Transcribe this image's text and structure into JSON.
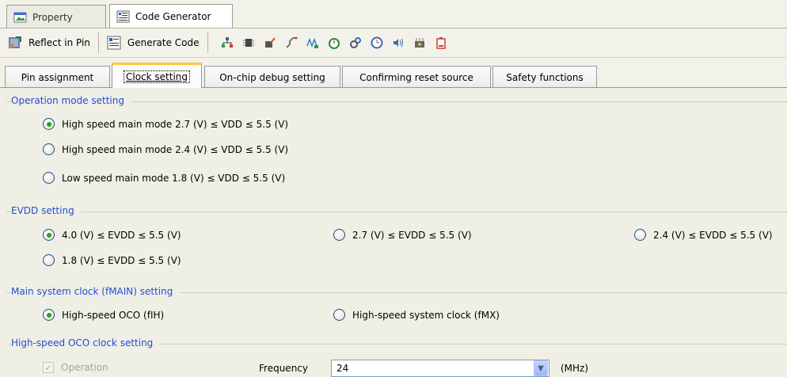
{
  "doc_tabs": [
    {
      "label": "Property",
      "icon": "property-icon",
      "active": false
    },
    {
      "label": "Code Generator",
      "icon": "code-generator-icon",
      "active": true
    }
  ],
  "toolbar": {
    "reflect_label": "Reflect in Pin",
    "generate_label": "Generate Code",
    "icons": [
      "pin-icon",
      "chip-icon",
      "edit-icon",
      "connector-icon",
      "wave-icon",
      "timer-icon",
      "gears-icon",
      "clock-icon",
      "sound-icon",
      "board-icon",
      "battery-icon"
    ]
  },
  "tabs": [
    {
      "label": "Pin assignment",
      "active": false
    },
    {
      "label": "Clock setting",
      "active": true
    },
    {
      "label": "On-chip debug setting",
      "active": false
    },
    {
      "label": "Confirming reset source",
      "active": false
    },
    {
      "label": "Safety functions",
      "active": false
    }
  ],
  "operation_mode": {
    "title": "Operation mode setting",
    "options": [
      {
        "label": "High speed main mode 2.7 (V) ≤ VDD ≤ 5.5 (V)",
        "checked": true
      },
      {
        "label": "High speed main mode 2.4 (V) ≤ VDD ≤ 5.5 (V)",
        "checked": false
      },
      {
        "label": "Low speed main mode 1.8 (V) ≤ VDD ≤ 5.5 (V)",
        "checked": false
      }
    ]
  },
  "evdd": {
    "title": "EVDD setting",
    "options": [
      {
        "label": "4.0 (V) ≤ EVDD ≤ 5.5 (V)",
        "checked": true
      },
      {
        "label": "2.7 (V) ≤ EVDD ≤ 5.5 (V)",
        "checked": false
      },
      {
        "label": "2.4 (V) ≤ EVDD ≤ 5.5 (V)",
        "checked": false
      },
      {
        "label": "1.8 (V) ≤ EVDD ≤ 5.5 (V)",
        "checked": false
      }
    ]
  },
  "main_clock": {
    "title": "Main system clock (fMAIN) setting",
    "options": [
      {
        "label": "High-speed OCO (fIH)",
        "checked": true
      },
      {
        "label": "High-speed system clock (fMX)",
        "checked": false
      }
    ]
  },
  "oco": {
    "title": "High-speed OCO clock setting",
    "operation_label": "Operation",
    "operation_checked": true,
    "frequency_label": "Frequency",
    "frequency_value": "24",
    "unit": "(MHz)"
  },
  "colors": {
    "group_title": "#1f4fd6",
    "radio_dot": "#21a121",
    "active_tab_accent": "#ffc83c"
  }
}
